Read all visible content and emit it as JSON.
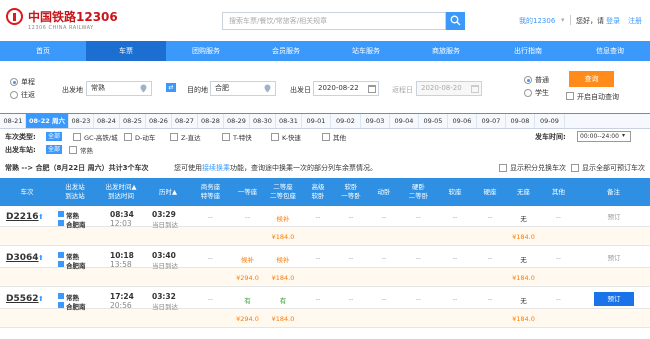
{
  "header": {
    "logo_cn": "中国铁路12306",
    "logo_en": "12306 CHINA RAILWAY",
    "search_placeholder": "搜索车票/餐饮/常旅客/相关规章",
    "my12306": "我的12306",
    "greeting": "您好，请",
    "login": "登录",
    "register": "注册"
  },
  "nav": [
    "首页",
    "车票",
    "团购服务",
    "会员服务",
    "站车服务",
    "商旅服务",
    "出行指南",
    "信息查询"
  ],
  "query": {
    "one_way": "单程",
    "round_trip": "往返",
    "from_label": "出发地",
    "from_value": "常熟",
    "to_label": "目的地",
    "to_value": "合肥",
    "date_label": "出发日",
    "date_value": "2020-08-22",
    "return_label": "返程日",
    "return_value": "2020-08-20",
    "normal": "普通",
    "student": "学生",
    "query_btn": "查询",
    "auto_query": "开启自动查询"
  },
  "dates": [
    "08-21",
    "08-22 周六",
    "08-23",
    "08-24",
    "08-25",
    "08-26",
    "08-27",
    "08-28",
    "08-29",
    "08-30",
    "08-31",
    "09-01",
    "09-02",
    "09-03",
    "09-04",
    "09-05",
    "09-06",
    "09-07",
    "09-08",
    "09-09"
  ],
  "filters": {
    "type_label": "车次类型:",
    "all": "全部",
    "types": [
      "GC-高铁/城",
      "D-动车",
      "Z-直达",
      "T-特快",
      "K-快速",
      "其他"
    ],
    "station_label": "出发车站:",
    "stations": [
      "常熟"
    ],
    "time_label": "发车时间:",
    "time_value": "00:00--24:00"
  },
  "results": {
    "summary": "常熟 --> 合肥（8月22日 周六）共计3个车次",
    "tip": "您可使用",
    "tip_link": "接续换乘",
    "tip_rest": "功能，查询途中换乘一次的部分列车余票情况。",
    "opt1": "显示积分兑换车次",
    "opt2": "显示全部可预订车次"
  },
  "columns": [
    "车次",
    "出发站\n到达站",
    "出发时间▲\n到达时间",
    "历时▲",
    "商务座\n特等座",
    "一等座",
    "二等座\n二等包座",
    "高级\n软卧",
    "软卧\n一等卧",
    "动卧",
    "硬卧\n二等卧",
    "软座",
    "硬座",
    "无座",
    "其他",
    "备注"
  ],
  "trains": [
    {
      "no": "D2216",
      "from": "常熟",
      "to": "合肥南",
      "dep": "08:34",
      "arr": "12:03",
      "dur": "03:29",
      "day": "当日到达",
      "cells": [
        "--",
        "--",
        "候补",
        "--",
        "--",
        "--",
        "--",
        "--",
        "--",
        "无",
        "--"
      ],
      "price_first": "",
      "price_second": "¥184.0",
      "price_noseat": "¥184.0",
      "book": "预订"
    },
    {
      "no": "D3064",
      "from": "常熟",
      "to": "合肥南",
      "dep": "10:18",
      "arr": "13:58",
      "dur": "03:40",
      "day": "当日到达",
      "cells": [
        "--",
        "候补",
        "候补",
        "--",
        "--",
        "--",
        "--",
        "--",
        "--",
        "无",
        "--"
      ],
      "price_first": "¥294.0",
      "price_second": "¥184.0",
      "price_noseat": "¥184.0",
      "book": "预订"
    },
    {
      "no": "D5562",
      "from": "常熟",
      "to": "合肥南",
      "dep": "17:24",
      "arr": "20:56",
      "dur": "03:32",
      "day": "当日到达",
      "cells": [
        "--",
        "有",
        "有",
        "--",
        "--",
        "--",
        "--",
        "--",
        "--",
        "无",
        "--"
      ],
      "price_first": "¥294.0",
      "price_second": "¥184.0",
      "price_noseat": "¥184.0",
      "book": "预订"
    }
  ],
  "colors": {
    "brand_red": "#c8151a",
    "nav_blue": "#3b99fc",
    "orange": "#ff8c1a",
    "green": "#2da22d"
  }
}
